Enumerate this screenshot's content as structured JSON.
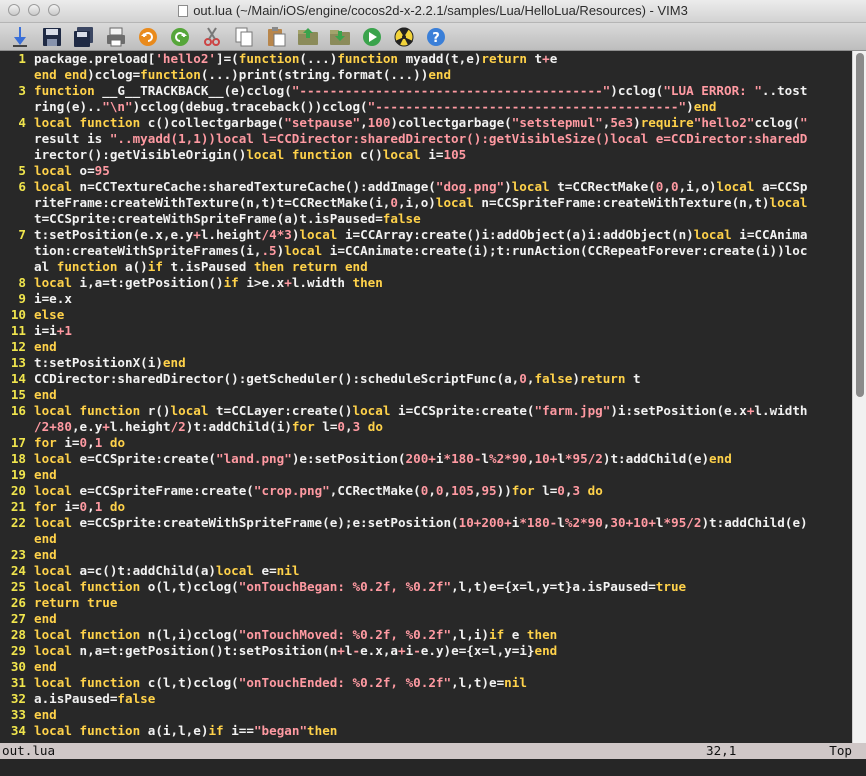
{
  "window": {
    "title": "out.lua (~/Main/iOS/engine/cocos2d-x-2.2.1/samples/Lua/HelloLua/Resources) - VIM3"
  },
  "toolbar": [
    {
      "name": "open-icon"
    },
    {
      "name": "save-icon"
    },
    {
      "name": "save-all-icon"
    },
    {
      "name": "print-icon"
    },
    {
      "name": "undo-icon"
    },
    {
      "name": "redo-icon"
    },
    {
      "name": "cut-icon"
    },
    {
      "name": "copy-icon"
    },
    {
      "name": "paste-icon"
    },
    {
      "name": "load-session-icon"
    },
    {
      "name": "save-session-icon"
    },
    {
      "name": "run-icon"
    },
    {
      "name": "make-icon"
    },
    {
      "name": "help-icon"
    }
  ],
  "lines": [
    {
      "num": "1",
      "code": "package.preload['hello2']=(function(...)function myadd(t,e)return t+e"
    },
    {
      "num": "",
      "code": "end end)cclog=function(...)print(string.format(...))end"
    },
    {
      "num": "3",
      "code": "function __G__TRACKBACK__(e)cclog(\"----------------------------------------\")cclog(\"LUA ERROR: \"..tost"
    },
    {
      "num": "",
      "code": "ring(e)..\"\\n\")cclog(debug.traceback())cclog(\"----------------------------------------\")end"
    },
    {
      "num": "4",
      "code": "local function c()collectgarbage(\"setpause\",100)collectgarbage(\"setstepmul\",5e3)require\"hello2\"cclog(\""
    },
    {
      "num": "",
      "code": "result is \"..myadd(1,1))local l=CCDirector:sharedDirector():getVisibleSize()local e=CCDirector:sharedD"
    },
    {
      "num": "",
      "code": "irector():getVisibleOrigin()local function c()local i=105"
    },
    {
      "num": "5",
      "code": "local o=95"
    },
    {
      "num": "6",
      "code": "local n=CCTextureCache:sharedTextureCache():addImage(\"dog.png\")local t=CCRectMake(0,0,i,o)local a=CCSp"
    },
    {
      "num": "",
      "code": "riteFrame:createWithTexture(n,t)t=CCRectMake(i,0,i,o)local n=CCSpriteFrame:createWithTexture(n,t)local"
    },
    {
      "num": "",
      "code": "t=CCSprite:createWithSpriteFrame(a)t.isPaused=false"
    },
    {
      "num": "7",
      "code": "t:setPosition(e.x,e.y+l.height/4*3)local i=CCArray:create()i:addObject(a)i:addObject(n)local i=CCAnima"
    },
    {
      "num": "",
      "code": "tion:createWithSpriteFrames(i,.5)local i=CCAnimate:create(i);t:runAction(CCRepeatForever:create(i))loc"
    },
    {
      "num": "",
      "code": "al function a()if t.isPaused then return end"
    },
    {
      "num": "8",
      "code": "local i,a=t:getPosition()if i>e.x+l.width then"
    },
    {
      "num": "9",
      "code": "i=e.x"
    },
    {
      "num": "10",
      "code": "else"
    },
    {
      "num": "11",
      "code": "i=i+1"
    },
    {
      "num": "12",
      "code": "end"
    },
    {
      "num": "13",
      "code": "t:setPositionX(i)end"
    },
    {
      "num": "14",
      "code": "CCDirector:sharedDirector():getScheduler():scheduleScriptFunc(a,0,false)return t"
    },
    {
      "num": "15",
      "code": "end"
    },
    {
      "num": "16",
      "code": "local function r()local t=CCLayer:create()local i=CCSprite:create(\"farm.jpg\")i:setPosition(e.x+l.width"
    },
    {
      "num": "",
      "code": "/2+80,e.y+l.height/2)t:addChild(i)for l=0,3 do"
    },
    {
      "num": "17",
      "code": "for i=0,1 do"
    },
    {
      "num": "18",
      "code": "local e=CCSprite:create(\"land.png\")e:setPosition(200+i*180-l%2*90,10+l*95/2)t:addChild(e)end"
    },
    {
      "num": "19",
      "code": "end"
    },
    {
      "num": "20",
      "code": "local e=CCSpriteFrame:create(\"crop.png\",CCRectMake(0,0,105,95))for l=0,3 do"
    },
    {
      "num": "21",
      "code": "for i=0,1 do"
    },
    {
      "num": "22",
      "code": "local e=CCSprite:createWithSpriteFrame(e);e:setPosition(10+200+i*180-l%2*90,30+10+l*95/2)t:addChild(e)"
    },
    {
      "num": "",
      "code": "end"
    },
    {
      "num": "23",
      "code": "end"
    },
    {
      "num": "24",
      "code": "local a=c()t:addChild(a)local e=nil"
    },
    {
      "num": "25",
      "code": "local function o(l,t)cclog(\"onTouchBegan: %0.2f, %0.2f\",l,t)e={x=l,y=t}a.isPaused=true"
    },
    {
      "num": "26",
      "code": "return true"
    },
    {
      "num": "27",
      "code": "end"
    },
    {
      "num": "28",
      "code": "local function n(l,i)cclog(\"onTouchMoved: %0.2f, %0.2f\",l,i)if e then"
    },
    {
      "num": "29",
      "code": "local n,a=t:getPosition()t:setPosition(n+l-e.x,a+i-e.y)e={x=l,y=i}end"
    },
    {
      "num": "30",
      "code": "end"
    },
    {
      "num": "31",
      "code": "local function c(l,t)cclog(\"onTouchEnded: %0.2f, %0.2f\",l,t)e=nil"
    },
    {
      "num": "32",
      "code": "a.isPaused=false"
    },
    {
      "num": "33",
      "code": "end"
    },
    {
      "num": "34",
      "code": "local function a(i,l,e)if i==\"began\"then"
    }
  ],
  "status": {
    "filename": "out.lua",
    "position": "32,1",
    "scroll": "Top"
  },
  "colors": {
    "background": "#282828",
    "line_number": "#f0e54d",
    "keyword": "#ffd24a",
    "string": "#ff9aa2",
    "text": "#f2f2f2",
    "status_bar": "#cfc7c7"
  }
}
